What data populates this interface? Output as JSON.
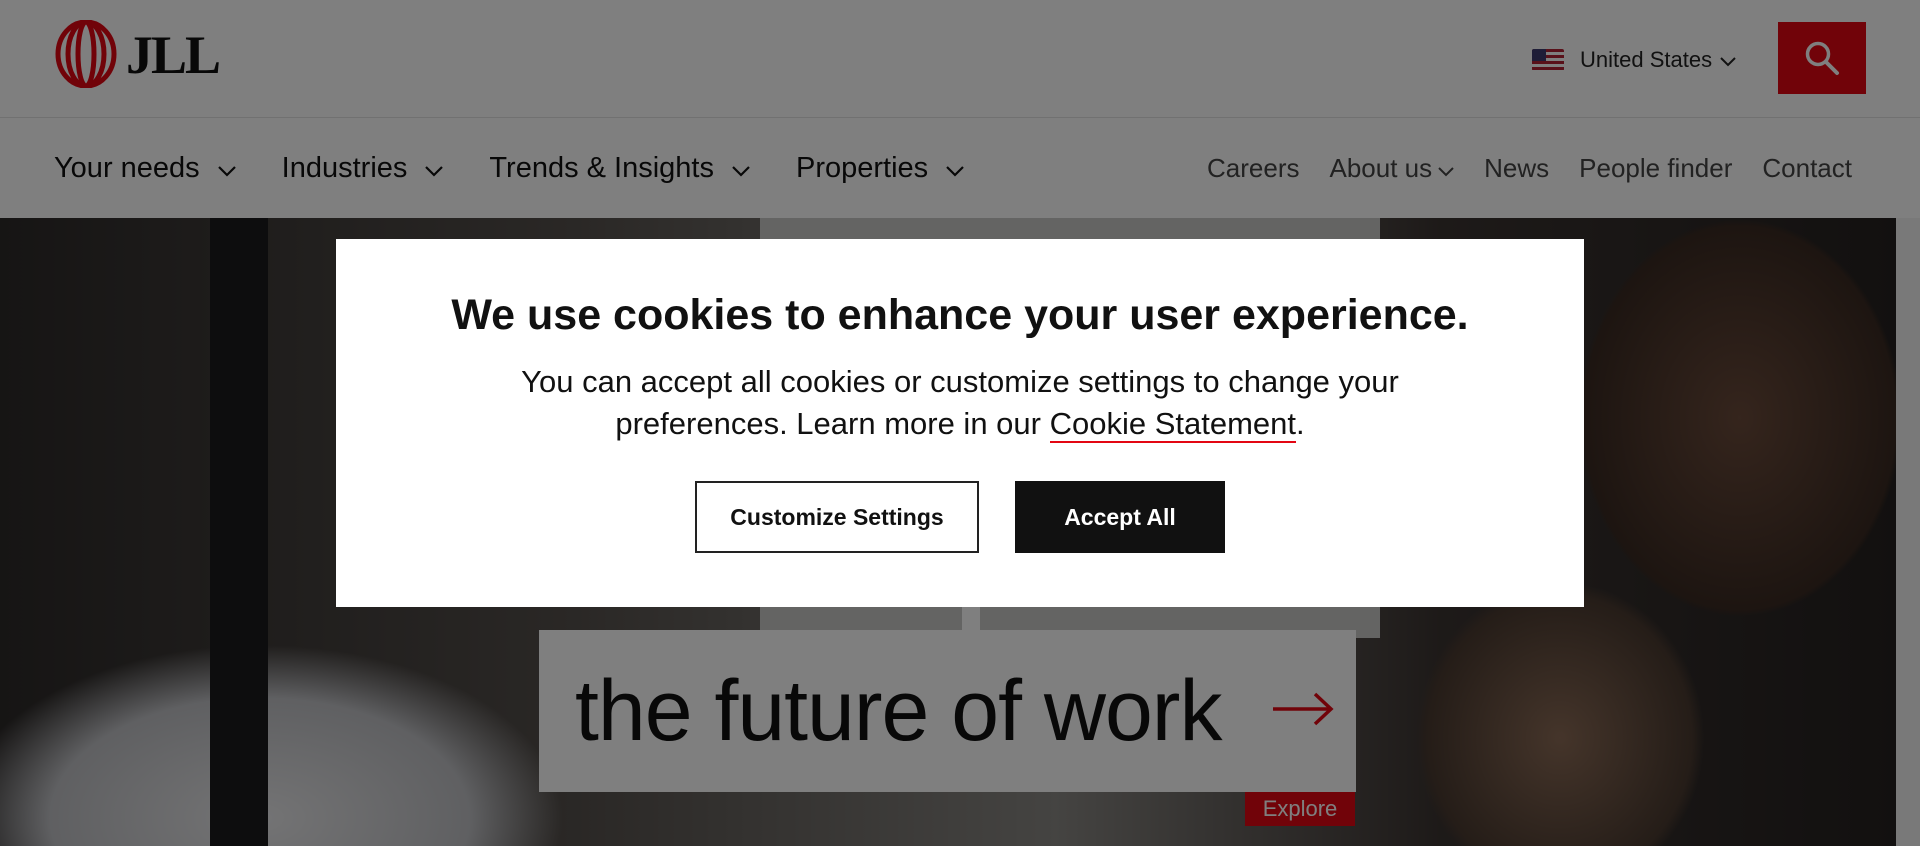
{
  "header": {
    "logo_text": "JLL",
    "region": {
      "label": "United States",
      "flag_icon": "us-flag-icon"
    },
    "search_icon": "search-icon"
  },
  "nav": {
    "primary": [
      {
        "label": "Your needs"
      },
      {
        "label": "Industries"
      },
      {
        "label": "Trends & Insights"
      },
      {
        "label": "Properties"
      }
    ],
    "secondary": [
      {
        "label": "Careers"
      },
      {
        "label": "About us"
      },
      {
        "label": "News"
      },
      {
        "label": "People finder"
      },
      {
        "label": "Contact"
      }
    ]
  },
  "hero": {
    "headline": "the future of work",
    "explore_label": "Explore"
  },
  "cookie_modal": {
    "title": "We use cookies to enhance your user experience.",
    "body_prefix": "You can accept all cookies or customize settings to change your preferences. Learn more in our ",
    "link_text": "Cookie Statement",
    "body_suffix": ".",
    "customize_label": "Customize Settings",
    "accept_label": "Accept All"
  },
  "colors": {
    "brand_red": "#e30613",
    "overlay": "rgba(0,0,0,0.5)",
    "accept_bg": "#111111"
  }
}
